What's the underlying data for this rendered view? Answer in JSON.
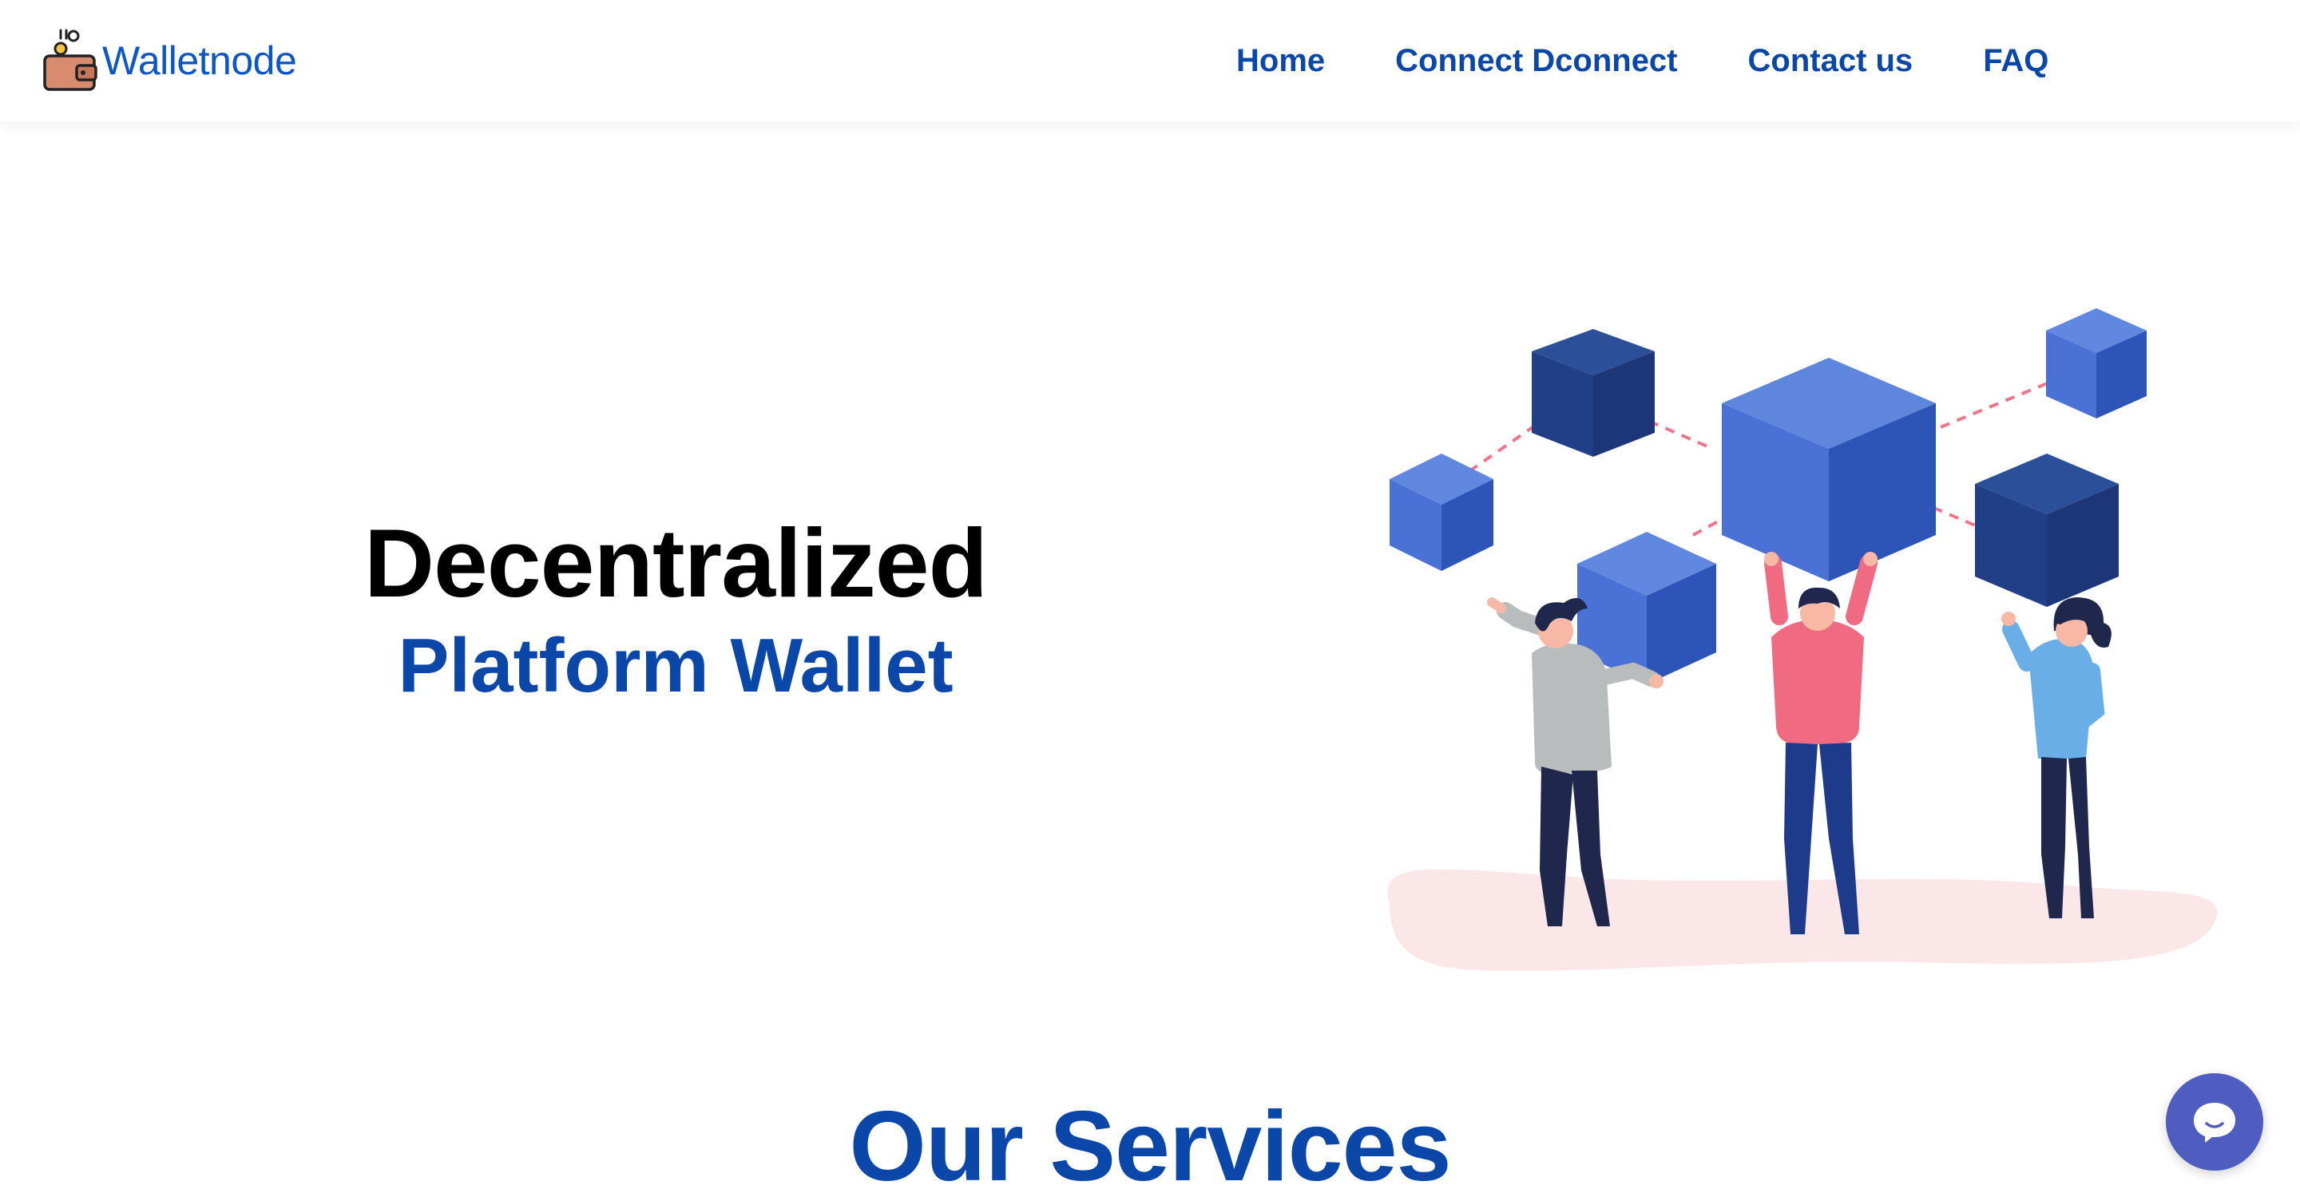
{
  "header": {
    "brand_name": "Walletnode",
    "brand_icon": "wallet-coins-icon",
    "nav": [
      {
        "label": "Home"
      },
      {
        "label": "Connect Dconnect"
      },
      {
        "label": "Contact us"
      },
      {
        "label": "FAQ"
      }
    ]
  },
  "hero": {
    "title": "Decentralized",
    "subtitle": "Platform Wallet",
    "illustration": "people-holding-blockchain-cubes-illustration"
  },
  "services": {
    "title": "Our Services"
  },
  "chat": {
    "icon": "chat-bubble-icon"
  },
  "colors": {
    "brand_blue": "#0b47a8",
    "logo_blue": "#0d56c6",
    "chat_purple": "#4f5dc0",
    "cube_light": "#4a72d6",
    "cube_dark": "#223f86",
    "ground_pink": "#fbe6e8"
  }
}
